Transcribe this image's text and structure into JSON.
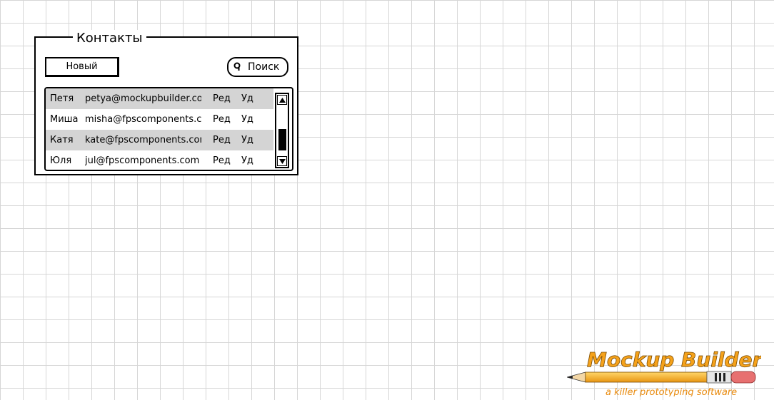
{
  "panel": {
    "title": "Контакты",
    "new_button_label": "Новый",
    "search_placeholder": "Поиск"
  },
  "contacts": [
    {
      "name": "Петя",
      "email": "petya@mockupbuilder.com",
      "edit": "Ред",
      "delete": "Уд"
    },
    {
      "name": "Миша",
      "email": "misha@fpscomponents.com",
      "edit": "Ред",
      "delete": "Уд"
    },
    {
      "name": "Катя",
      "email": "kate@fpscomponents.com",
      "edit": "Ред",
      "delete": "Уд"
    },
    {
      "name": "Юля",
      "email": "jul@fpscomponents.com",
      "edit": "Ред",
      "delete": "Уд"
    }
  ],
  "logo": {
    "name": "Mockup Builder",
    "tagline": "a killer prototyping software"
  },
  "colors": {
    "alt_row": "#d4d4d4",
    "logo_orange": "#f5a21b",
    "grid": "#d6d6d6"
  }
}
